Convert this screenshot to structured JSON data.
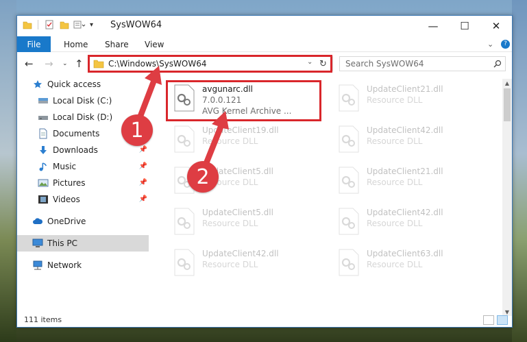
{
  "window": {
    "title": "SysWOW64"
  },
  "ribbon": {
    "file": "File",
    "home": "Home",
    "share": "Share",
    "view": "View"
  },
  "address": {
    "path": "C:\\Windows\\SysWOW64"
  },
  "search": {
    "placeholder": "Search SysWOW64"
  },
  "sidebar": {
    "items": [
      {
        "label": "Quick access",
        "icon": "star-icon"
      },
      {
        "label": "Local Disk (C:)",
        "icon": "drive-icon"
      },
      {
        "label": "Local Disk (D:)",
        "icon": "drive-icon"
      },
      {
        "label": "Documents",
        "icon": "documents-icon"
      },
      {
        "label": "Downloads",
        "icon": "download-icon"
      },
      {
        "label": "Music",
        "icon": "music-icon"
      },
      {
        "label": "Pictures",
        "icon": "pictures-icon"
      },
      {
        "label": "Videos",
        "icon": "videos-icon"
      },
      {
        "label": "OneDrive",
        "icon": "cloud-icon"
      },
      {
        "label": "This PC",
        "icon": "computer-icon"
      },
      {
        "label": "Network",
        "icon": "network-icon"
      }
    ]
  },
  "files": [
    {
      "name": "avgunarc.dll",
      "version": "7.0.0.121",
      "desc": "AVG Kernel Archive ..."
    },
    {
      "name": "UpdateClient21.dll",
      "desc": "Resource DLL"
    },
    {
      "name": "UpdateClient19.dll",
      "desc": "Resource DLL"
    },
    {
      "name": "UpdateClient42.dll",
      "desc": "Resource DLL"
    },
    {
      "name": "UpdateClient5.dll",
      "desc": "Resource DLL"
    },
    {
      "name": "UpdateClient21.dll",
      "desc": "Resource DLL"
    },
    {
      "name": "UpdateClient5.dll",
      "desc": "Resource DLL"
    },
    {
      "name": "UpdateClient42.dll",
      "desc": "Resource DLL"
    },
    {
      "name": "UpdateClient42.dll",
      "desc": "Resource DLL"
    },
    {
      "name": "UpdateClient63.dll",
      "desc": "Resource DLL"
    }
  ],
  "status": {
    "count": "111 items"
  },
  "annotations": {
    "step1": "1",
    "step2": "2"
  },
  "colors": {
    "accent": "#1979ca",
    "highlight": "#d9262b",
    "selected": "#d9d9d9"
  }
}
